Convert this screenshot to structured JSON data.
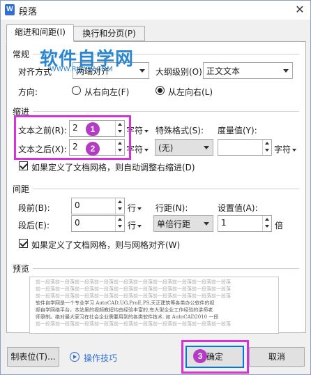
{
  "window": {
    "title": "段落",
    "app_icon": "W",
    "close_glyph": "✕"
  },
  "tabs": [
    {
      "label": "缩进和间距(I)",
      "active": true
    },
    {
      "label": "换行和分页(P)",
      "active": false
    }
  ],
  "general": {
    "section": "常规",
    "align_label": "对齐方式",
    "align_value": "两端对齐",
    "outline_label": "大纲级别(O):",
    "outline_value": "正文文本",
    "direction_label": "方向:",
    "rtl_label": "从右向左(F)",
    "ltr_label": "从左向右(L)",
    "direction_selected": "ltr"
  },
  "indent": {
    "section": "缩进",
    "before_label": "文本之前(R):",
    "before_value": "2",
    "before_unit": "字符",
    "after_label": "文本之后(X):",
    "after_value": "2",
    "after_unit": "字符",
    "special_label": "特殊格式(S):",
    "special_value": "(无)",
    "measure_label": "度量值(Y):",
    "measure_value": "",
    "measure_unit": "字符",
    "grid_check_label": "如果定义了文档网格，则自动调整右缩进(D)",
    "grid_checked": true
  },
  "spacing": {
    "section": "间距",
    "before_label": "段前(B):",
    "before_value": "0",
    "before_unit": "行",
    "after_label": "段后(E):",
    "after_value": "0",
    "after_unit": "行",
    "line_label": "行距(N):",
    "line_value": "单倍行距",
    "setting_label": "设置值(A):",
    "setting_value": "1",
    "setting_unit": "倍",
    "grid_check_label": "如果定义了文档网格，则与网格对齐(W)",
    "grid_checked": true
  },
  "preview": {
    "section": "预览",
    "filler_line": "前一段落前一段落前一段落前一段落前一段落前一段落前一段落前一段落前一段落前一段落",
    "sample_lines": [
      "软件自学网是一个专业学习 AutoCAD,UG,ProE,PS,天正建筑等各类办公软件的视",
      "频自学网络平台，本站里的视频教程均由经验丰富的,有大型企业工作经验的讲师老",
      "师录制。绝对最大家习在社会企业需要用到的各类软件技术. 如 AutoCAD2010 一段"
    ]
  },
  "annotations": {
    "badge_1": "1",
    "badge_2": "2",
    "badge_3": "3",
    "highlight_color": "#d633d6",
    "badge_color": "#b43cc4"
  },
  "watermark": {
    "title": "软件自学网",
    "url": "WWW.RJZXW.COM"
  },
  "buttons": {
    "tabs_label": "制表位(T)...",
    "tips_label": "操作技巧",
    "ok_label": "确定",
    "cancel_label": "取消"
  },
  "colors": {
    "accent": "#0078d7",
    "link": "#2f6fd6",
    "watermark": "#2b86d0"
  }
}
